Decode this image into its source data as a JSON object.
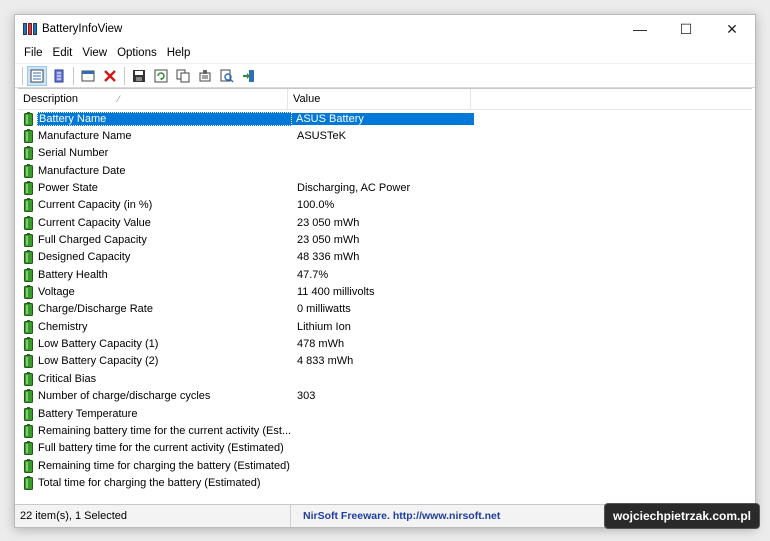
{
  "window": {
    "title": "BatteryInfoView"
  },
  "controls": {
    "minimize": "—",
    "maximize": "☐",
    "close": "✕"
  },
  "menu": [
    "File",
    "Edit",
    "View",
    "Options",
    "Help"
  ],
  "toolbar_icons": [
    "properties-icon",
    "battery-info-icon",
    "html-report-icon",
    "delete-icon",
    "save-icon",
    "refresh-icon",
    "copy-icon",
    "options-icon",
    "find-icon",
    "exit-icon"
  ],
  "list": {
    "columns": {
      "description": "Description",
      "value": "Value"
    },
    "rows": [
      {
        "desc": "Battery Name",
        "value": "ASUS Battery",
        "selected": true
      },
      {
        "desc": "Manufacture Name",
        "value": "ASUSTeK"
      },
      {
        "desc": "Serial Number",
        "value": ""
      },
      {
        "desc": "Manufacture Date",
        "value": ""
      },
      {
        "desc": "Power State",
        "value": "Discharging, AC Power"
      },
      {
        "desc": "Current Capacity (in %)",
        "value": "100.0%"
      },
      {
        "desc": "Current Capacity Value",
        "value": "23 050 mWh"
      },
      {
        "desc": "Full Charged Capacity",
        "value": "23 050 mWh"
      },
      {
        "desc": "Designed Capacity",
        "value": "48 336 mWh"
      },
      {
        "desc": "Battery Health",
        "value": "47.7%"
      },
      {
        "desc": "Voltage",
        "value": "11 400 millivolts"
      },
      {
        "desc": "Charge/Discharge Rate",
        "value": "0 milliwatts"
      },
      {
        "desc": "Chemistry",
        "value": "Lithium Ion"
      },
      {
        "desc": "Low Battery Capacity (1)",
        "value": "478 mWh"
      },
      {
        "desc": "Low Battery Capacity (2)",
        "value": "4 833 mWh"
      },
      {
        "desc": "Critical Bias",
        "value": ""
      },
      {
        "desc": "Number of charge/discharge cycles",
        "value": "303"
      },
      {
        "desc": "Battery Temperature",
        "value": ""
      },
      {
        "desc": "Remaining battery time for the current activity (Est...",
        "value": ""
      },
      {
        "desc": "Full battery time for the current activity (Estimated)",
        "value": ""
      },
      {
        "desc": "Remaining time for charging the battery (Estimated)",
        "value": ""
      },
      {
        "desc": "Total  time for charging the battery (Estimated)",
        "value": ""
      }
    ]
  },
  "status": {
    "items": "22 item(s), 1 Selected",
    "link": "NirSoft Freeware.  http://www.nirsoft.net"
  },
  "watermark": "wojciechpietrzak.com.pl",
  "colors": {
    "selection": "#0078d7",
    "battery": "#3a9a2e",
    "link": "#1f3fa0"
  }
}
